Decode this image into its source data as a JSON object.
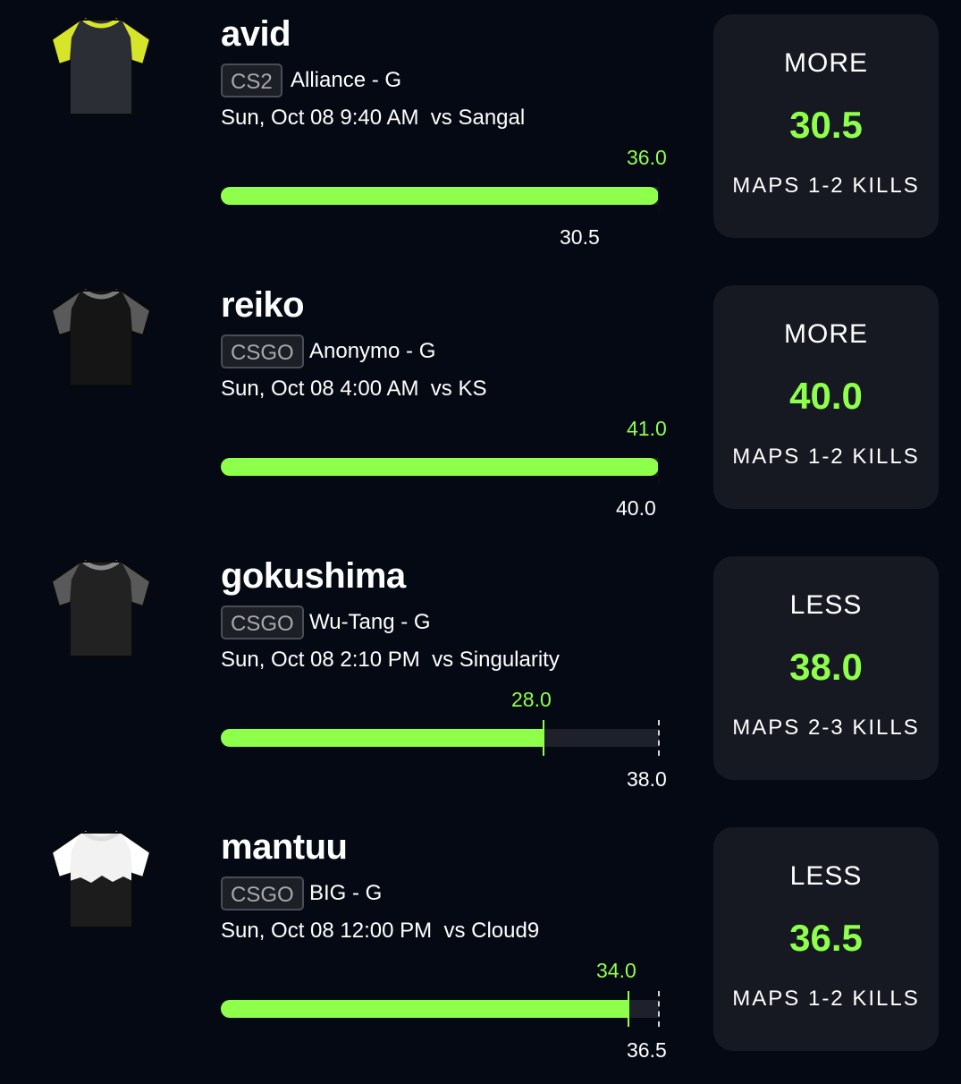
{
  "players": [
    {
      "name": "avid",
      "game": "CS2",
      "team": "Alliance - G",
      "match": "Sun, Oct 08 9:40 AM  vs Sangal",
      "actual_label": "36.0",
      "line_label": "30.5",
      "actual_value": 36.0,
      "line_value": 30.5,
      "pick": {
        "direction": "MORE",
        "value": "30.5",
        "stat": "MAPS 1-2 KILLS"
      },
      "jersey": {
        "icon": "jersey-icon",
        "body": "#2b2f35",
        "sleeve": "#d7e52a",
        "collar": "#d7e52a"
      }
    },
    {
      "name": "reiko",
      "game": "CSGO",
      "team": "Anonymo - G",
      "match": "Sun, Oct 08 4:00 AM  vs KS",
      "actual_label": "41.0",
      "line_label": "40.0",
      "actual_value": 41.0,
      "line_value": 40.0,
      "pick": {
        "direction": "MORE",
        "value": "40.0",
        "stat": "MAPS 1-2 KILLS"
      },
      "jersey": {
        "icon": "jersey-icon",
        "body": "#151515",
        "sleeve": "#5a5a5a",
        "collar": "#7a7a7a"
      }
    },
    {
      "name": "gokushima",
      "game": "CSGO",
      "team": "Wu-Tang - G",
      "match": "Sun, Oct 08 2:10 PM  vs Singularity",
      "actual_label": "28.0",
      "line_label": "38.0",
      "actual_value": 28.0,
      "line_value": 38.0,
      "pick": {
        "direction": "LESS",
        "value": "38.0",
        "stat": "MAPS 2-3 KILLS"
      },
      "jersey": {
        "icon": "jersey-icon",
        "body": "#222222",
        "sleeve": "#595959",
        "collar": "#8a8a8a"
      }
    },
    {
      "name": "mantuu",
      "game": "CSGO",
      "team": "BIG - G",
      "match": "Sun, Oct 08 12:00 PM  vs Cloud9",
      "actual_label": "34.0",
      "line_label": "36.5",
      "actual_value": 34.0,
      "line_value": 36.5,
      "pick": {
        "direction": "LESS",
        "value": "36.5",
        "stat": "MAPS 1-2 KILLS"
      },
      "jersey": {
        "icon": "jersey-icon",
        "body": "#f2f2f2",
        "sleeve": "#ffffff",
        "collar": "#dddddd",
        "bottom": "#1c1c1c"
      }
    }
  ]
}
